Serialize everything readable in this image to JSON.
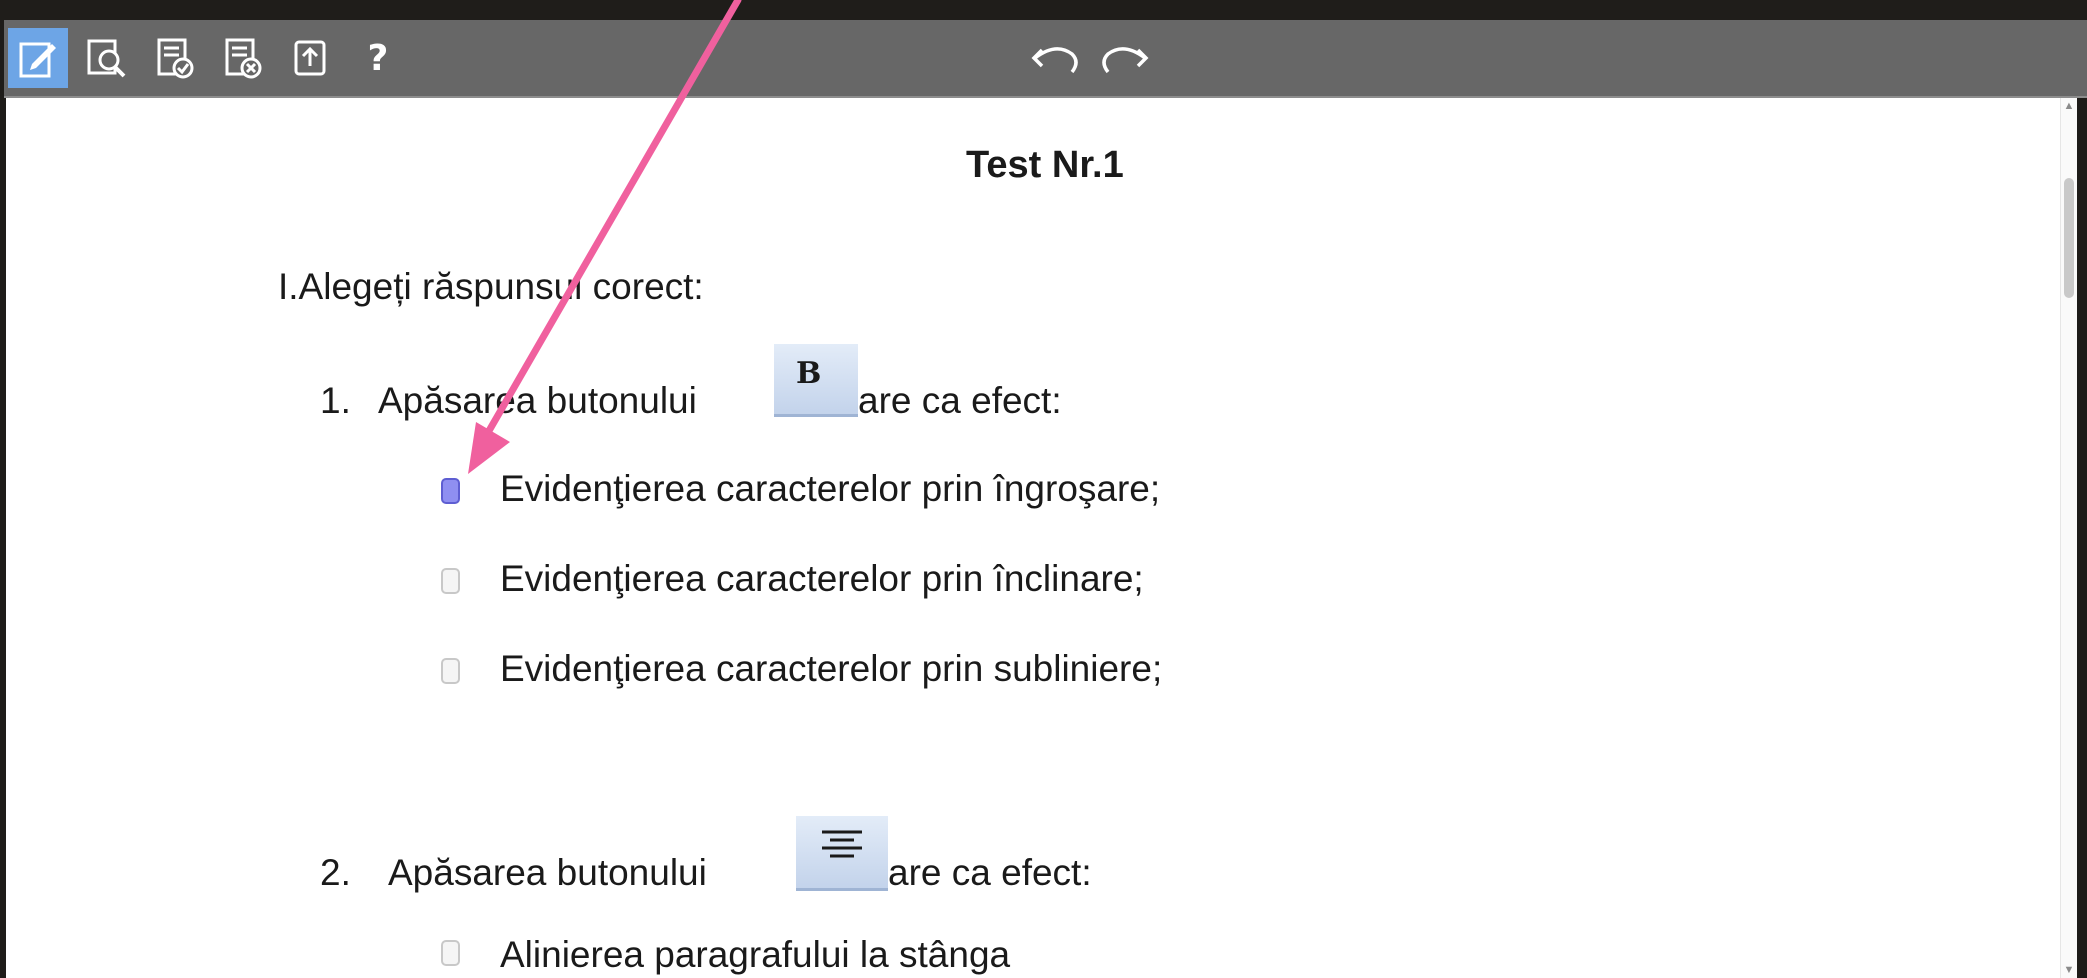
{
  "toolbar": {
    "buttons": [
      {
        "name": "edit-icon",
        "active": true
      },
      {
        "name": "preview-icon",
        "active": false
      },
      {
        "name": "check-document-icon",
        "active": false
      },
      {
        "name": "clear-document-icon",
        "active": false
      },
      {
        "name": "export-icon",
        "active": false
      }
    ],
    "help_label": "?",
    "undo_icon": "undo-icon",
    "redo_icon": "redo-icon",
    "active_color": "#6da5e6",
    "bar_color": "#676767"
  },
  "document": {
    "title": "Test Nr.1",
    "section": "I.Alegeți răspunsul corect:",
    "questions": [
      {
        "number": "1.",
        "prefix": "Apăsarea butonului",
        "suffix": "are ca efect:",
        "button_icon": "bold-icon",
        "button_glyph": "B",
        "options": [
          {
            "label": "Evidenţierea caracterelor prin îngroşare;",
            "checked": true
          },
          {
            "label": "Evidenţierea caracterelor prin înclinare;",
            "checked": false
          },
          {
            "label": "Evidenţierea caracterelor prin subliniere;",
            "checked": false
          }
        ]
      },
      {
        "number": "2.",
        "prefix": "Apăsarea butonului",
        "suffix": "are ca efect:",
        "button_icon": "align-center-icon",
        "options": [
          {
            "label": "Alinierea paragrafului la stânga",
            "checked": false
          }
        ]
      }
    ]
  },
  "annotation": {
    "type": "arrow",
    "color": "#f0609e"
  }
}
